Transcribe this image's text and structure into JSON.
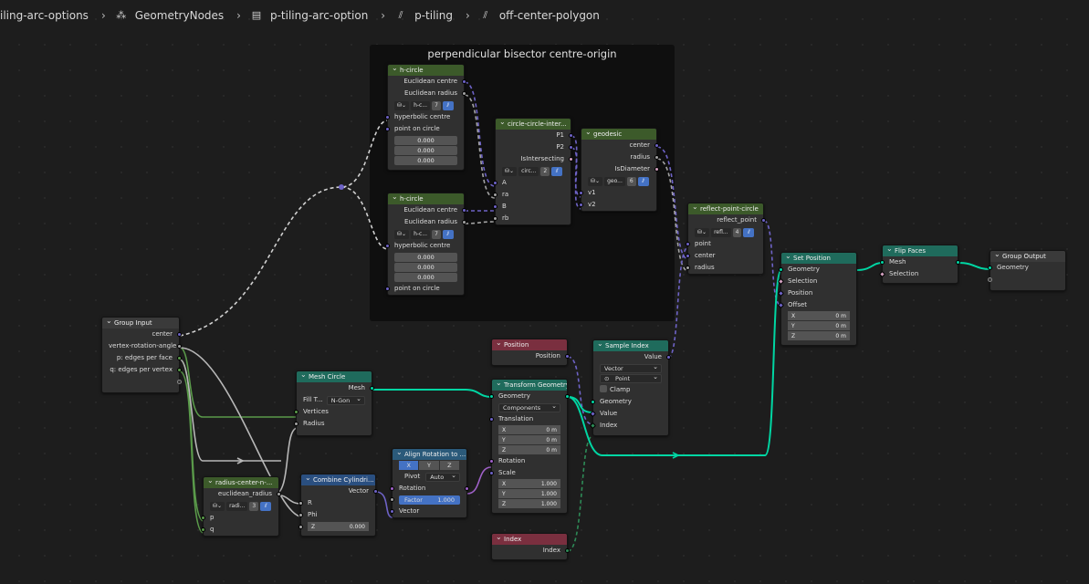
{
  "breadcrumbs": [
    {
      "label": "iling-arc-options",
      "icon": "none"
    },
    {
      "label": "GeometryNodes",
      "icon": "nodes-modifier-icon"
    },
    {
      "label": "p-tiling-arc-option",
      "icon": "node-tree-icon"
    },
    {
      "label": "p-tiling",
      "icon": "node-group-icon"
    },
    {
      "label": "off-center-polygon",
      "icon": "node-group-icon"
    }
  ],
  "frame": {
    "title": "perpendicular bisector centre-origin"
  },
  "nodes": {
    "hcircle1": {
      "title": "h-circle",
      "out1": "Euclidean centre",
      "out2": "Euclidean radius",
      "tree": "h-c...",
      "users": "7",
      "in1": "hyperbolic centre",
      "in2": "point on circle",
      "v1": "0.000",
      "v2": "0.000",
      "v3": "0.000"
    },
    "hcircle2": {
      "title": "h-circle",
      "out1": "Euclidean centre",
      "out2": "Euclidean radius",
      "tree": "h-c...",
      "users": "7",
      "in1": "hyperbolic centre",
      "v1": "0.000",
      "v2": "0.000",
      "v3": "0.000",
      "in2": "point on circle"
    },
    "cci": {
      "title": "circle-circle-inter...",
      "out1": "P1",
      "out2": "P2",
      "out3": "IsIntersecting",
      "tree": "circ...",
      "users": "2",
      "in1": "A",
      "in2": "ra",
      "in3": "B",
      "in4": "rb"
    },
    "geodesic": {
      "title": "geodesic",
      "out1": "center",
      "out2": "radius",
      "out3": "IsDiameter",
      "tree": "geo...",
      "users": "6",
      "in1": "v1",
      "in2": "v2"
    },
    "reflect": {
      "title": "reflect-point-circle",
      "out1": "reflect_point",
      "tree": "refl...",
      "users": "4",
      "in1": "point",
      "in2": "center",
      "in3": "radius"
    },
    "setpos": {
      "title": "Set Position",
      "in1": "Geometry",
      "in2": "Selection",
      "in3": "Position",
      "in4": "Offset",
      "x": "X",
      "xv": "0 m",
      "y": "Y",
      "yv": "0 m",
      "z": "Z",
      "zv": "0 m"
    },
    "flip": {
      "title": "Flip Faces",
      "in1": "Mesh",
      "in2": "Selection"
    },
    "gout": {
      "title": "Group Output",
      "in1": "Geometry"
    },
    "gin": {
      "title": "Group Input",
      "o1": "center",
      "o2": "vertex-rotation-angle",
      "o3": "p: edges per face",
      "o4": "q: edges per vertex"
    },
    "meshcircle": {
      "title": "Mesh Circle",
      "out1": "Mesh",
      "fill_label": "Fill T...",
      "fill_value": "N-Gon",
      "in1": "Vertices",
      "in2": "Radius"
    },
    "position": {
      "title": "Position",
      "out1": "Position"
    },
    "transform": {
      "title": "Transform Geometry",
      "in1": "Geometry",
      "mode": "Components",
      "trans": "Translation",
      "tx": "X",
      "txv": "0 m",
      "ty": "Y",
      "tyv": "0 m",
      "tz": "Z",
      "tzv": "0 m",
      "rot": "Rotation",
      "scale": "Scale",
      "sx": "X",
      "sxv": "1.000",
      "sy": "Y",
      "syv": "1.000",
      "sz": "Z",
      "szv": "1.000"
    },
    "sample": {
      "title": "Sample Index",
      "out1": "Value",
      "type": "Vector",
      "domain": "Point",
      "clamp": "Clamp",
      "in1": "Geometry",
      "in2": "Value",
      "in3": "Index"
    },
    "index": {
      "title": "Index",
      "out1": "Index"
    },
    "radius": {
      "title": "radius-center-n-...",
      "out1": "euclidean_radius",
      "tree": "radi...",
      "users": "3",
      "in1": "p",
      "in2": "q"
    },
    "combine": {
      "title": "Combine Cylindri...",
      "out1": "Vector",
      "in1": "R",
      "in2": "Phi",
      "z": "Z",
      "zv": "0.000"
    },
    "align": {
      "title": "Align Rotation to ...",
      "ax": "X",
      "ay": "Y",
      "az": "Z",
      "pivot_label": "Pivot",
      "pivot_value": "Auto",
      "in1": "Rotation",
      "factor_label": "Factor",
      "factor_value": "1.000",
      "in2": "Vector"
    }
  }
}
